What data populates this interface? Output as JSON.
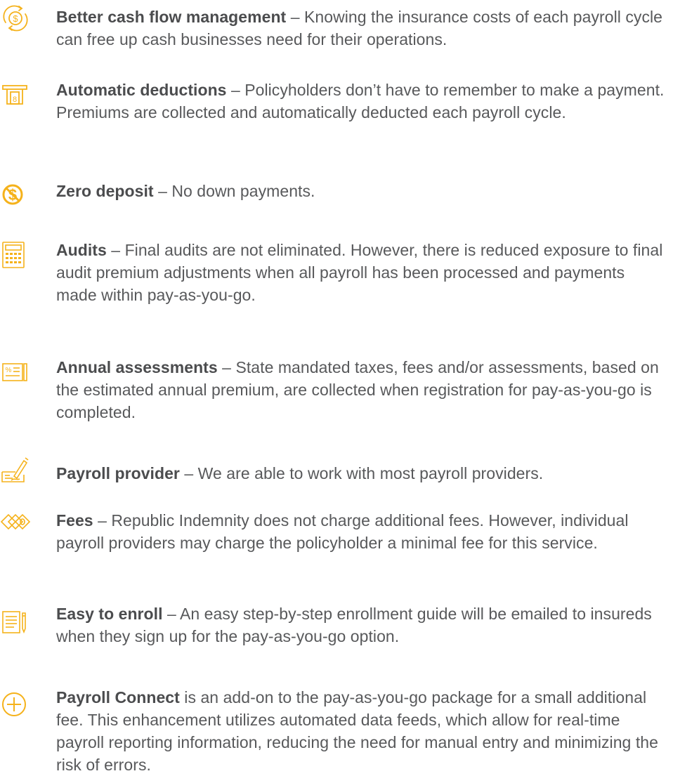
{
  "accent_color": "#f5b21b",
  "text_color": "#58595b",
  "items": [
    {
      "icon": "cash-flow-cycle-icon",
      "title": "Better cash flow management",
      "body": " – Knowing the insurance costs of each payroll cycle can free up cash businesses need for their operations."
    },
    {
      "icon": "atm-icon",
      "title": "Automatic deductions",
      "body": " – Policyholders don’t have to remember to make a payment. Premiums are collected and automatically deducted each payroll cycle."
    },
    {
      "icon": "no-dollar-icon",
      "title": "Zero deposit",
      "body": " – No down payments."
    },
    {
      "icon": "calculator-icon",
      "title": "Audits",
      "body": " – Final audits are not eliminated. However, there is reduced exposure to final audit premium adjustments when all payroll has been processed and payments made within pay-as-you-go."
    },
    {
      "icon": "percent-document-icon",
      "title": "Annual assessments",
      "body": " – State mandated taxes, fees and/or assessments, based on the estimated annual premium, are collected when registration for pay-as-you-go is completed."
    },
    {
      "icon": "check-signing-icon",
      "title": "Payroll provider",
      "body": " – We are able to work with most payroll providers."
    },
    {
      "icon": "money-bills-icon",
      "title": "Fees",
      "body": " – Republic Indemnity does not charge additional fees. However, individual payroll providers may charge the policyholder a minimal fee for this service."
    },
    {
      "icon": "document-pencil-icon",
      "title": "Easy to enroll",
      "body": " – An easy step-by-step enrollment guide will be emailed to insureds when they sign up for the pay-as-you-go option."
    },
    {
      "icon": "plus-circle-icon",
      "title": "Payroll Connect",
      "body": " is an add-on to the pay-as-you-go package for a small additional fee. This enhancement utilizes automated data feeds, which allow for real-time payroll reporting information, reducing the need for manual entry and minimizing the risk of errors."
    }
  ]
}
